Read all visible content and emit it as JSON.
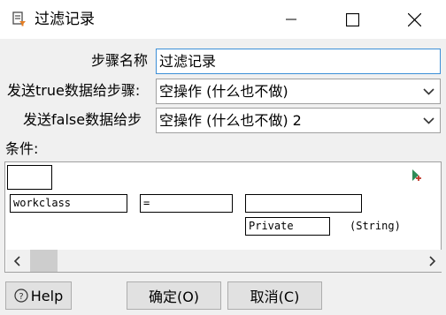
{
  "window": {
    "title": "过滤记录",
    "title_icon": "filter-rows-icon",
    "controls": [
      "minimize-icon",
      "maximize-icon",
      "close-icon"
    ]
  },
  "form": {
    "step_name_label": "步骤名称",
    "step_name_value": "过滤记录",
    "true_label": "发送true数据给步骤:",
    "true_value": "空操作 (什么也不做)",
    "false_label": "发送false数据给步",
    "false_value": "空操作 (什么也不做) 2"
  },
  "conditions": {
    "label": "条件:",
    "add_icon": "add-condition-icon",
    "field": "workclass",
    "operator": "=",
    "compare_field": "",
    "value": "Private",
    "value_type": "(String)"
  },
  "buttons": {
    "help": "Help",
    "ok": "确定(O)",
    "cancel": "取消(C)"
  }
}
